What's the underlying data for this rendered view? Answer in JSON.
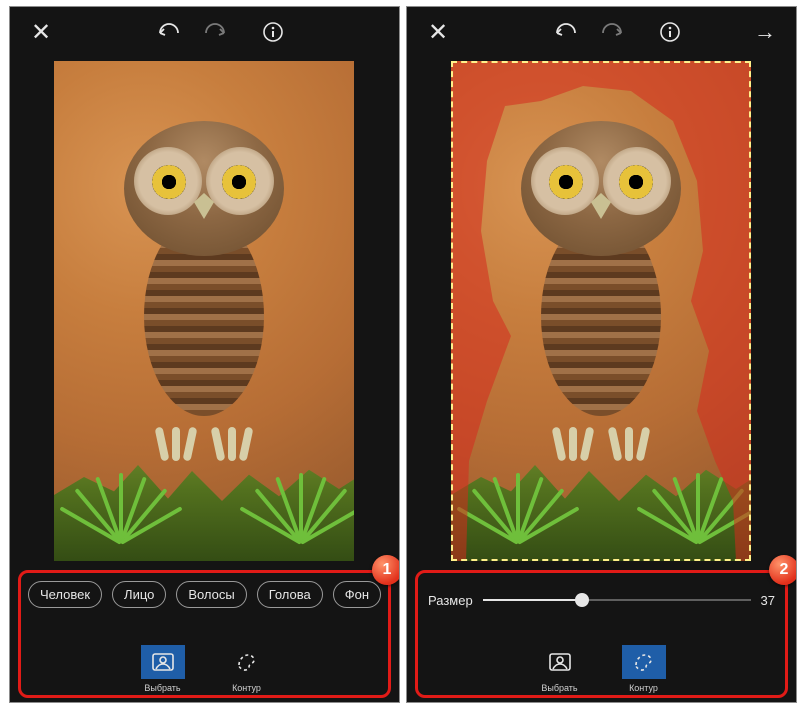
{
  "badges": {
    "left": "1",
    "right": "2"
  },
  "categories": [
    "Человек",
    "Лицо",
    "Волосы",
    "Голова",
    "Фон"
  ],
  "tools": {
    "select": "Выбрать",
    "contour": "Контур"
  },
  "left": {
    "active_tool": "select"
  },
  "right": {
    "active_tool": "contour",
    "slider_label": "Размер",
    "slider_value": "37",
    "slider_percent": 37
  }
}
